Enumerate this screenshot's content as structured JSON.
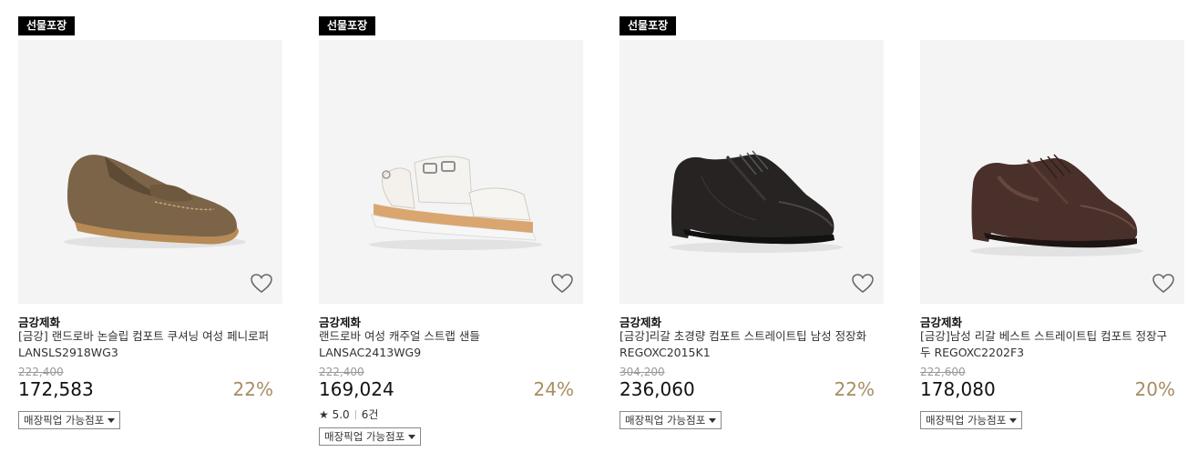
{
  "products": [
    {
      "badge": "선물포장",
      "brand": "금강제화",
      "name": "[금강] 랜드로바 논슬립 컴포트 쿠셔닝 여성 페니로퍼 LANSLS2918WG3",
      "original_price": "222,400",
      "price": "172,583",
      "discount": "22%",
      "pickup_label": "매장픽업 가능점포",
      "image_icon": "loafer-shoe"
    },
    {
      "badge": "선물포장",
      "brand": "금강제화",
      "name": "랜드로바 여성 캐주얼 스트랩 샌들 LANSAC2413WG9",
      "original_price": "222,400",
      "price": "169,024",
      "discount": "24%",
      "rating_score": "5.0",
      "rating_count": "6건",
      "pickup_label": "매장픽업 가능점포",
      "image_icon": "sandal-shoe"
    },
    {
      "badge": "선물포장",
      "brand": "금강제화",
      "name": "[금강]리갈 초경량 컴포트 스트레이트팁 남성 정장화 REGOXC2015K1",
      "original_price": "304,200",
      "price": "236,060",
      "discount": "22%",
      "pickup_label": "매장픽업 가능점포",
      "image_icon": "oxford-shoe-black"
    },
    {
      "brand": "금강제화",
      "name": "[금강]남성 리갈 베스트 스트레이트팁 컴포트 정장구두 REGOXC2202F3",
      "original_price": "222,600",
      "price": "178,080",
      "discount": "20%",
      "pickup_label": "매장픽업 가능점포",
      "image_icon": "oxford-shoe-brown"
    }
  ],
  "colors": {
    "badge_bg": "#000000",
    "image_bg": "#f4f4f4",
    "discount": "#a58e62",
    "original_price": "#999999"
  }
}
